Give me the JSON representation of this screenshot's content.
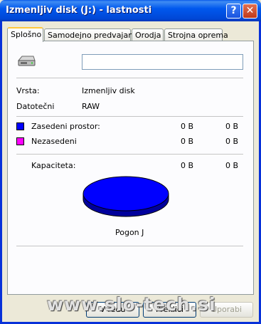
{
  "window": {
    "title": "Izmenljiv disk (J:) - lastnosti",
    "help_label": "?",
    "close_label": "✕"
  },
  "tabs": [
    {
      "label": "Splošno",
      "active": true
    },
    {
      "label": "Samodejno predvajanje",
      "active": false
    },
    {
      "label": "Orodja",
      "active": false
    },
    {
      "label": "Strojna oprema",
      "active": false
    }
  ],
  "general": {
    "drive_icon": "removable-drive-icon",
    "volume_label": "",
    "type_label": "Vrsta:",
    "type_value": "Izmenljiv disk",
    "filesystem_label": "Datotečni",
    "filesystem_value": "RAW",
    "used_label": "Zasedeni prostor:",
    "used_bytes": "0 B",
    "used_size": "0 B",
    "free_label": "Nezasedeni",
    "free_bytes": "0 B",
    "free_size": "0 B",
    "capacity_label": "Kapaciteta:",
    "capacity_bytes": "0 B",
    "capacity_size": "0 B",
    "drive_caption": "Pogon J",
    "used_color": "#0000ff",
    "free_color": "#ff00ff"
  },
  "buttons": {
    "ok_label": "V redu",
    "cancel_label": "Prekliči",
    "apply_label": "Uporabi"
  },
  "watermark": "www.slo-tech.si"
}
